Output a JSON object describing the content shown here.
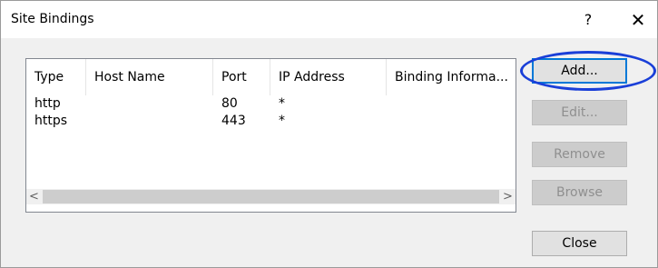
{
  "window": {
    "title": "Site Bindings",
    "help_label": "?",
    "close_label": "✕"
  },
  "table": {
    "columns": [
      "Type",
      "Host Name",
      "Port",
      "IP Address",
      "Binding Informa..."
    ],
    "rows": [
      [
        "http",
        "",
        "80",
        "*",
        ""
      ],
      [
        "https",
        "",
        "443",
        "*",
        ""
      ]
    ]
  },
  "scrollbar": {
    "left_arrow": "<",
    "right_arrow": ">"
  },
  "buttons": {
    "add": "Add...",
    "edit": "Edit...",
    "remove": "Remove",
    "browse": "Browse",
    "close": "Close"
  },
  "colors": {
    "highlight": "#1a3fd8",
    "focus_border": "#0078d7"
  }
}
